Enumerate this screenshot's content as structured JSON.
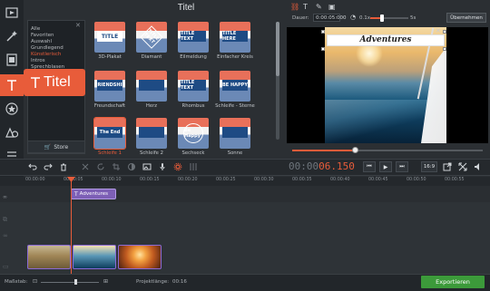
{
  "rail": {
    "items": [
      "media",
      "magic",
      "filmstrip",
      "titles",
      "stickers",
      "transitions",
      "more"
    ],
    "active_index": 3
  },
  "callout": {
    "label": "Titel"
  },
  "categories": {
    "items": [
      "Alle",
      "Favoriten",
      "Auswahl",
      "Grundlegend",
      "Künstlerisch",
      "Intros",
      "Sprechblasen"
    ],
    "selected": "Künstlerisch",
    "store_label": "Store"
  },
  "gallery": {
    "heading": "Titel",
    "tiles": [
      {
        "label": "3D-Plakat",
        "badge": "TITLE",
        "style": "white",
        "selected": false
      },
      {
        "label": "Diamant",
        "badge": "TITLE TEXT",
        "style": "dia",
        "selected": false
      },
      {
        "label": "Eilmeldung",
        "badge": "TITLE TEXT",
        "style": "plain",
        "selected": false
      },
      {
        "label": "Einfacher Kreis",
        "badge": "TITLE HERE",
        "style": "plain",
        "selected": false
      },
      {
        "label": "Freundschaft",
        "badge": "FRIENDSHIP",
        "style": "plain",
        "selected": false
      },
      {
        "label": "Herz",
        "badge": "",
        "style": "plain",
        "selected": false
      },
      {
        "label": "Rhombus",
        "badge": "TITLE TEXT",
        "style": "plain",
        "selected": false
      },
      {
        "label": "Schleife - Sterne",
        "badge": "BE HAPPY",
        "style": "plain",
        "selected": false
      },
      {
        "label": "Schleife 1",
        "badge": "The End",
        "style": "plain",
        "selected": true
      },
      {
        "label": "Schleife 2",
        "badge": "",
        "style": "plain",
        "selected": false
      },
      {
        "label": "Sechseck",
        "badge": "Be Happy",
        "style": "circle",
        "selected": false
      },
      {
        "label": "Sonne",
        "badge": "",
        "style": "plain",
        "selected": false
      }
    ]
  },
  "preview_bar": {
    "duration_label": "Dauer:",
    "duration_value": "0:00:05:000",
    "speed_value": "0.1x",
    "speed_max": "5s",
    "speed_fraction": 0.3,
    "apply_label": "Übernehmen"
  },
  "preview": {
    "overlay_title": "Adventures",
    "progress_fraction": 0.33
  },
  "timecode": {
    "dim": "00:00",
    "bright": "06.150"
  },
  "aspect_label": "16:9",
  "ruler_ticks": [
    "00:00:00",
    "00:00:05",
    "00:00:10",
    "00:00:15",
    "00:00:20",
    "00:00:25",
    "00:00:30",
    "00:00:35",
    "00:00:40",
    "00:00:45",
    "00:00:50",
    "00:00:55"
  ],
  "timeline": {
    "title_clip_label": "Adventures",
    "video_clips": [
      "clip-desert",
      "clip-ocean",
      "clip-sunset"
    ]
  },
  "footer": {
    "scale_label": "Maßstab:",
    "zoom_fraction": 0.6,
    "project_length_label": "Projektlänge:",
    "project_length_value": "00:16",
    "export_label": "Exportieren"
  },
  "colors": {
    "accent": "#e85c3a",
    "export": "#3c9a3a",
    "title_clip": "#7d5fb6"
  }
}
